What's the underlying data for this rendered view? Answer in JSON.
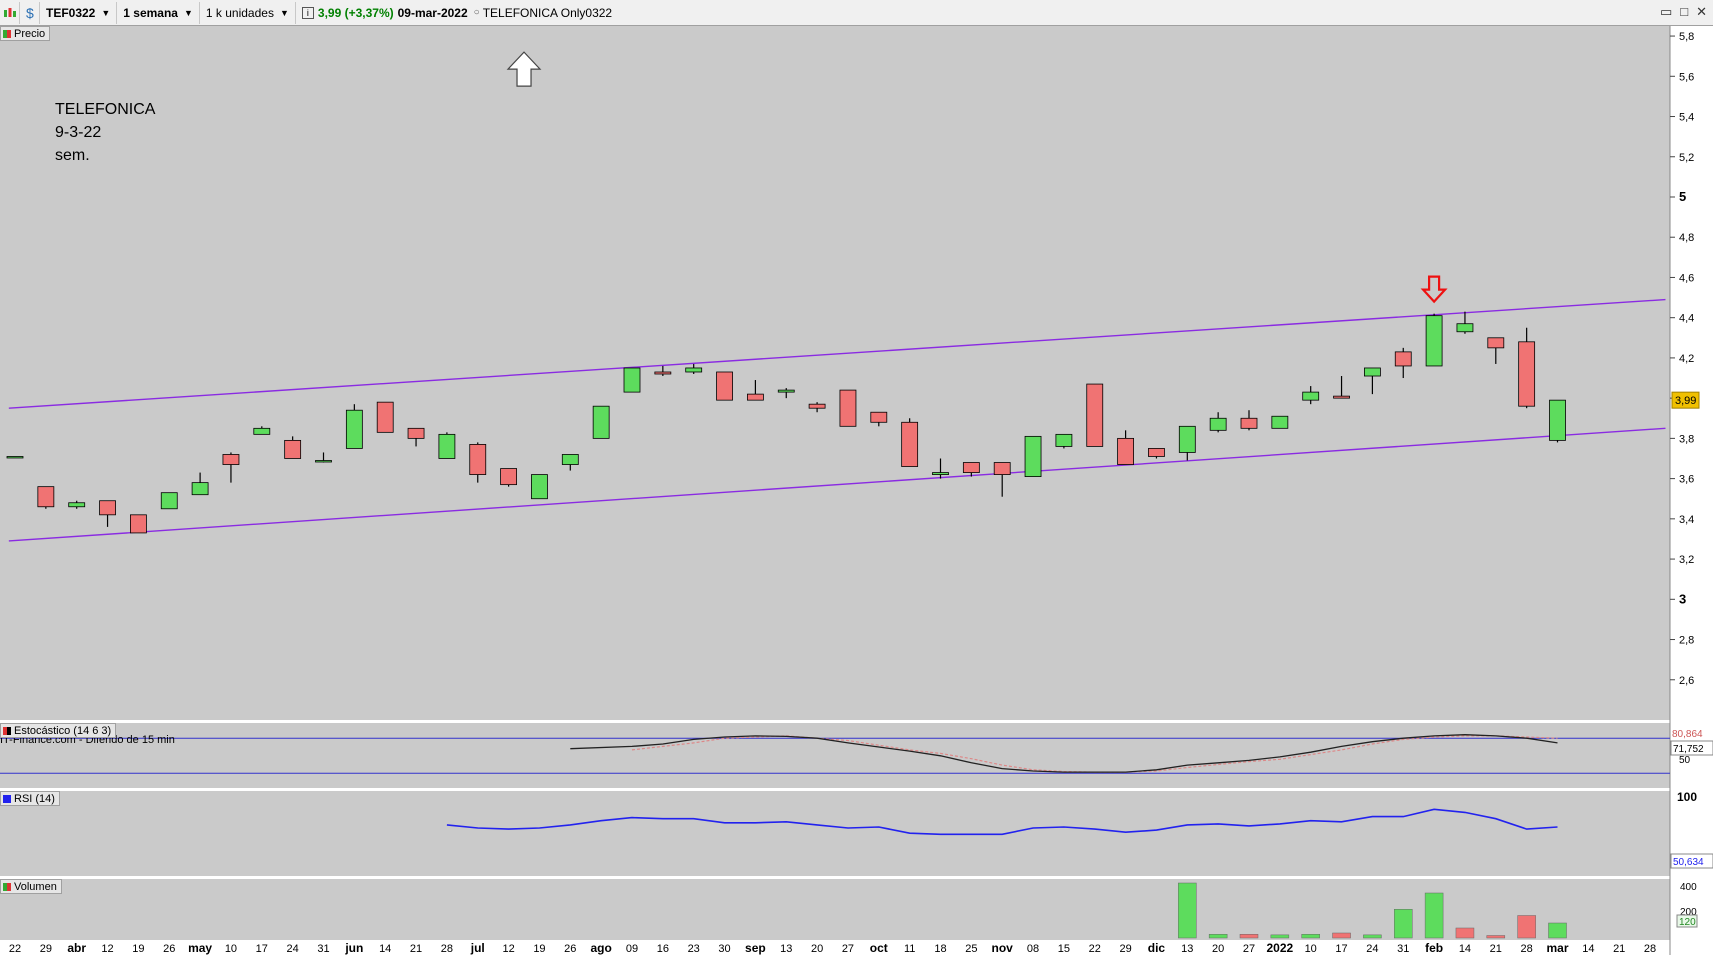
{
  "toolbar": {
    "symbol": "TEF0322",
    "timeframe": "1 semana",
    "units": "1 k unidades",
    "info_icon": "i",
    "quote": "3,99 (+3,37%)",
    "date": "09-mar-2022",
    "instrument": "TELEFONICA Only0322",
    "icons": [
      "candlestick-chart-icon",
      "dollar-icon",
      "info-icon"
    ]
  },
  "window_buttons": [
    "minimize-icon",
    "maximize-icon",
    "close-icon"
  ],
  "panels": {
    "price": "Precio",
    "stochastic": "Estocástico (14 6 3)",
    "rsi": "RSI (14)",
    "volume": "Volumen"
  },
  "note_lines": [
    "TELEFONICA",
    "9-3-22",
    "sem."
  ],
  "source_text": "IT-Finance.com - Diferido de 15 min",
  "colors": {
    "chart_bg": "#cacaca",
    "up": "#5ddc5d",
    "down": "#f07373",
    "channel": "#8a2be2",
    "rsi": "#2222ee",
    "marker_red": "#ee1111",
    "price_badge": "#f0c000"
  },
  "chart_data": {
    "type": "candlestick",
    "price_axis": {
      "range": [
        2.4,
        5.85
      ],
      "ticks": [
        "5,8",
        "5,6",
        "5,4",
        "5,2",
        "5",
        "4,8",
        "4,6",
        "4,4",
        "4,2",
        "4",
        "3,8",
        "3,6",
        "3,4",
        "3,2",
        "3",
        "2,8",
        "2,6"
      ],
      "last_price": "3,99"
    },
    "x_labels": [
      {
        "i": 0,
        "t": "22",
        "b": false
      },
      {
        "i": 1,
        "t": "29",
        "b": false
      },
      {
        "i": 2,
        "t": "abr",
        "b": true
      },
      {
        "i": 3,
        "t": "12",
        "b": false
      },
      {
        "i": 4,
        "t": "19",
        "b": false
      },
      {
        "i": 5,
        "t": "26",
        "b": false
      },
      {
        "i": 6,
        "t": "may",
        "b": true
      },
      {
        "i": 7,
        "t": "10",
        "b": false
      },
      {
        "i": 8,
        "t": "17",
        "b": false
      },
      {
        "i": 9,
        "t": "24",
        "b": false
      },
      {
        "i": 10,
        "t": "31",
        "b": false
      },
      {
        "i": 11,
        "t": "jun",
        "b": true
      },
      {
        "i": 12,
        "t": "14",
        "b": false
      },
      {
        "i": 13,
        "t": "21",
        "b": false
      },
      {
        "i": 14,
        "t": "28",
        "b": false
      },
      {
        "i": 15,
        "t": "jul",
        "b": true
      },
      {
        "i": 16,
        "t": "12",
        "b": false
      },
      {
        "i": 17,
        "t": "19",
        "b": false
      },
      {
        "i": 18,
        "t": "26",
        "b": false
      },
      {
        "i": 19,
        "t": "ago",
        "b": true
      },
      {
        "i": 20,
        "t": "09",
        "b": false
      },
      {
        "i": 21,
        "t": "16",
        "b": false
      },
      {
        "i": 22,
        "t": "23",
        "b": false
      },
      {
        "i": 23,
        "t": "30",
        "b": false
      },
      {
        "i": 24,
        "t": "sep",
        "b": true
      },
      {
        "i": 25,
        "t": "13",
        "b": false
      },
      {
        "i": 26,
        "t": "20",
        "b": false
      },
      {
        "i": 27,
        "t": "27",
        "b": false
      },
      {
        "i": 28,
        "t": "oct",
        "b": true
      },
      {
        "i": 29,
        "t": "11",
        "b": false
      },
      {
        "i": 30,
        "t": "18",
        "b": false
      },
      {
        "i": 31,
        "t": "25",
        "b": false
      },
      {
        "i": 32,
        "t": "nov",
        "b": true
      },
      {
        "i": 33,
        "t": "08",
        "b": false
      },
      {
        "i": 34,
        "t": "15",
        "b": false
      },
      {
        "i": 35,
        "t": "22",
        "b": false
      },
      {
        "i": 36,
        "t": "29",
        "b": false
      },
      {
        "i": 37,
        "t": "dic",
        "b": true
      },
      {
        "i": 38,
        "t": "13",
        "b": false
      },
      {
        "i": 39,
        "t": "20",
        "b": false
      },
      {
        "i": 40,
        "t": "27",
        "b": false
      },
      {
        "i": 41,
        "t": "2022",
        "b": true
      },
      {
        "i": 42,
        "t": "10",
        "b": false
      },
      {
        "i": 43,
        "t": "17",
        "b": false
      },
      {
        "i": 44,
        "t": "24",
        "b": false
      },
      {
        "i": 45,
        "t": "31",
        "b": false
      },
      {
        "i": 46,
        "t": "feb",
        "b": true
      },
      {
        "i": 47,
        "t": "14",
        "b": false
      },
      {
        "i": 48,
        "t": "21",
        "b": false
      },
      {
        "i": 49,
        "t": "28",
        "b": false
      },
      {
        "i": 50,
        "t": "mar",
        "b": true
      },
      {
        "i": 51,
        "t": "14",
        "b": false
      },
      {
        "i": 52,
        "t": "21",
        "b": false
      },
      {
        "i": 53,
        "t": "28",
        "b": false
      }
    ],
    "candles": [
      {
        "i": 0,
        "o": 3.71,
        "h": 3.71,
        "l": 3.71,
        "c": 3.71
      },
      {
        "i": 1,
        "o": 3.56,
        "h": 3.56,
        "l": 3.45,
        "c": 3.46
      },
      {
        "i": 2,
        "o": 3.46,
        "h": 3.49,
        "l": 3.45,
        "c": 3.48
      },
      {
        "i": 3,
        "o": 3.49,
        "h": 3.49,
        "l": 3.36,
        "c": 3.42
      },
      {
        "i": 4,
        "o": 3.42,
        "h": 3.42,
        "l": 3.33,
        "c": 3.33
      },
      {
        "i": 5,
        "o": 3.45,
        "h": 3.53,
        "l": 3.45,
        "c": 3.53
      },
      {
        "i": 6,
        "o": 3.52,
        "h": 3.63,
        "l": 3.52,
        "c": 3.58
      },
      {
        "i": 7,
        "o": 3.72,
        "h": 3.73,
        "l": 3.58,
        "c": 3.67
      },
      {
        "i": 8,
        "o": 3.82,
        "h": 3.86,
        "l": 3.82,
        "c": 3.85
      },
      {
        "i": 9,
        "o": 3.79,
        "h": 3.81,
        "l": 3.7,
        "c": 3.7
      },
      {
        "i": 10,
        "o": 3.69,
        "h": 3.73,
        "l": 3.68,
        "c": 3.69
      },
      {
        "i": 11,
        "o": 3.75,
        "h": 3.97,
        "l": 3.75,
        "c": 3.94
      },
      {
        "i": 12,
        "o": 3.98,
        "h": 3.98,
        "l": 3.83,
        "c": 3.83
      },
      {
        "i": 13,
        "o": 3.85,
        "h": 3.85,
        "l": 3.76,
        "c": 3.8
      },
      {
        "i": 14,
        "o": 3.7,
        "h": 3.83,
        "l": 3.7,
        "c": 3.82
      },
      {
        "i": 15,
        "o": 3.77,
        "h": 3.78,
        "l": 3.58,
        "c": 3.62
      },
      {
        "i": 16,
        "o": 3.65,
        "h": 3.65,
        "l": 3.56,
        "c": 3.57
      },
      {
        "i": 17,
        "o": 3.5,
        "h": 3.62,
        "l": 3.5,
        "c": 3.62
      },
      {
        "i": 18,
        "o": 3.67,
        "h": 3.72,
        "l": 3.64,
        "c": 3.72
      },
      {
        "i": 19,
        "o": 3.8,
        "h": 3.96,
        "l": 3.8,
        "c": 3.96
      },
      {
        "i": 20,
        "o": 4.03,
        "h": 4.15,
        "l": 4.03,
        "c": 4.15
      },
      {
        "i": 21,
        "o": 4.13,
        "h": 4.16,
        "l": 4.11,
        "c": 4.12
      },
      {
        "i": 22,
        "o": 4.13,
        "h": 4.17,
        "l": 4.12,
        "c": 4.15
      },
      {
        "i": 23,
        "o": 4.13,
        "h": 4.13,
        "l": 3.99,
        "c": 3.99
      },
      {
        "i": 24,
        "o": 4.02,
        "h": 4.09,
        "l": 3.99,
        "c": 3.99
      },
      {
        "i": 25,
        "o": 4.03,
        "h": 4.05,
        "l": 4.0,
        "c": 4.04
      },
      {
        "i": 26,
        "o": 3.97,
        "h": 3.98,
        "l": 3.93,
        "c": 3.95
      },
      {
        "i": 27,
        "o": 4.04,
        "h": 4.04,
        "l": 3.86,
        "c": 3.86
      },
      {
        "i": 28,
        "o": 3.93,
        "h": 3.93,
        "l": 3.86,
        "c": 3.88
      },
      {
        "i": 29,
        "o": 3.88,
        "h": 3.9,
        "l": 3.66,
        "c": 3.66
      },
      {
        "i": 30,
        "o": 3.62,
        "h": 3.7,
        "l": 3.6,
        "c": 3.63
      },
      {
        "i": 31,
        "o": 3.68,
        "h": 3.68,
        "l": 3.61,
        "c": 3.63
      },
      {
        "i": 32,
        "o": 3.68,
        "h": 3.68,
        "l": 3.51,
        "c": 3.62
      },
      {
        "i": 33,
        "o": 3.61,
        "h": 3.81,
        "l": 3.61,
        "c": 3.81
      },
      {
        "i": 34,
        "o": 3.76,
        "h": 3.82,
        "l": 3.75,
        "c": 3.82
      },
      {
        "i": 35,
        "o": 4.07,
        "h": 4.07,
        "l": 3.76,
        "c": 3.76
      },
      {
        "i": 36,
        "o": 3.8,
        "h": 3.84,
        "l": 3.67,
        "c": 3.67
      },
      {
        "i": 37,
        "o": 3.75,
        "h": 3.75,
        "l": 3.7,
        "c": 3.71
      },
      {
        "i": 38,
        "o": 3.73,
        "h": 3.86,
        "l": 3.69,
        "c": 3.86
      },
      {
        "i": 39,
        "o": 3.84,
        "h": 3.93,
        "l": 3.83,
        "c": 3.9
      },
      {
        "i": 40,
        "o": 3.9,
        "h": 3.94,
        "l": 3.84,
        "c": 3.85
      },
      {
        "i": 41,
        "o": 3.85,
        "h": 3.91,
        "l": 3.85,
        "c": 3.91
      },
      {
        "i": 42,
        "o": 3.99,
        "h": 4.06,
        "l": 3.97,
        "c": 4.03
      },
      {
        "i": 43,
        "o": 4.01,
        "h": 4.11,
        "l": 4.0,
        "c": 4.0
      },
      {
        "i": 44,
        "o": 4.11,
        "h": 4.15,
        "l": 4.02,
        "c": 4.15
      },
      {
        "i": 45,
        "o": 4.23,
        "h": 4.25,
        "l": 4.1,
        "c": 4.16
      },
      {
        "i": 46,
        "o": 4.16,
        "h": 4.42,
        "l": 4.16,
        "c": 4.41
      },
      {
        "i": 47,
        "o": 4.33,
        "h": 4.43,
        "l": 4.32,
        "c": 4.37
      },
      {
        "i": 48,
        "o": 4.3,
        "h": 4.3,
        "l": 4.17,
        "c": 4.25
      },
      {
        "i": 49,
        "o": 4.28,
        "h": 4.35,
        "l": 3.95,
        "c": 3.96
      },
      {
        "i": 50,
        "o": 3.79,
        "h": 3.99,
        "l": 3.78,
        "c": 3.99
      }
    ],
    "channel_lines": [
      {
        "x0": -0.2,
        "y0": 3.95,
        "x1": 53.5,
        "y1": 4.49
      },
      {
        "x0": -0.2,
        "y0": 3.29,
        "x1": 53.5,
        "y1": 3.85
      }
    ],
    "annotations": [
      {
        "type": "arrow-up",
        "x": 16.5,
        "y": 5.72,
        "color": "#ffffff"
      },
      {
        "type": "arrow-down",
        "x": 46,
        "y": 4.48,
        "color": "#ee1111"
      }
    ],
    "stochastic": {
      "range": [
        0,
        100
      ],
      "levels": [
        80,
        20
      ],
      "ticks": [
        "80,864",
        "71,752",
        "50"
      ],
      "k": [
        [
          18,
          62
        ],
        [
          20,
          66
        ],
        [
          21,
          70
        ],
        [
          22,
          78
        ],
        [
          23,
          82
        ],
        [
          24,
          84
        ],
        [
          25,
          83
        ],
        [
          26,
          80
        ],
        [
          27,
          72
        ],
        [
          28,
          65
        ],
        [
          29,
          58
        ],
        [
          30,
          50
        ],
        [
          31,
          38
        ],
        [
          32,
          28
        ],
        [
          33,
          24
        ],
        [
          34,
          22
        ],
        [
          35,
          22
        ],
        [
          36,
          22
        ],
        [
          37,
          26
        ],
        [
          38,
          34
        ],
        [
          39,
          38
        ],
        [
          40,
          42
        ],
        [
          41,
          48
        ],
        [
          42,
          56
        ],
        [
          43,
          66
        ],
        [
          44,
          74
        ],
        [
          45,
          80
        ],
        [
          46,
          84
        ],
        [
          47,
          86
        ],
        [
          48,
          84
        ],
        [
          49,
          80
        ],
        [
          50,
          72
        ]
      ],
      "d": [
        [
          20,
          60
        ],
        [
          21,
          66
        ],
        [
          22,
          72
        ],
        [
          23,
          80
        ],
        [
          24,
          82
        ],
        [
          25,
          84
        ],
        [
          26,
          80
        ],
        [
          27,
          76
        ],
        [
          28,
          68
        ],
        [
          29,
          60
        ],
        [
          30,
          54
        ],
        [
          31,
          45
        ],
        [
          32,
          34
        ],
        [
          33,
          26
        ],
        [
          34,
          23
        ],
        [
          35,
          22
        ],
        [
          36,
          22
        ],
        [
          37,
          24
        ],
        [
          38,
          30
        ],
        [
          39,
          35
        ],
        [
          40,
          40
        ],
        [
          41,
          44
        ],
        [
          42,
          52
        ],
        [
          43,
          60
        ],
        [
          44,
          70
        ],
        [
          45,
          78
        ],
        [
          46,
          82
        ],
        [
          47,
          84
        ],
        [
          48,
          84
        ],
        [
          49,
          82
        ],
        [
          50,
          80
        ]
      ],
      "last_k": "71,752",
      "last_d": "80,864"
    },
    "rsi": {
      "range": [
        0,
        100
      ],
      "ticks": [
        "100"
      ],
      "values": [
        [
          14,
          52
        ],
        [
          15,
          49
        ],
        [
          16,
          48
        ],
        [
          17,
          49
        ],
        [
          18,
          52
        ],
        [
          19,
          56
        ],
        [
          20,
          59
        ],
        [
          21,
          58
        ],
        [
          22,
          58
        ],
        [
          23,
          54
        ],
        [
          24,
          54
        ],
        [
          25,
          55
        ],
        [
          26,
          52
        ],
        [
          27,
          49
        ],
        [
          28,
          50
        ],
        [
          29,
          44
        ],
        [
          30,
          43
        ],
        [
          31,
          43
        ],
        [
          32,
          43
        ],
        [
          33,
          49
        ],
        [
          34,
          50
        ],
        [
          35,
          48
        ],
        [
          36,
          45
        ],
        [
          37,
          47
        ],
        [
          38,
          52
        ],
        [
          39,
          53
        ],
        [
          40,
          51
        ],
        [
          41,
          53
        ],
        [
          42,
          56
        ],
        [
          43,
          55
        ],
        [
          44,
          60
        ],
        [
          45,
          60
        ],
        [
          46,
          67
        ],
        [
          47,
          64
        ],
        [
          48,
          58
        ],
        [
          49,
          48
        ],
        [
          50,
          50
        ]
      ],
      "last": "50,634"
    },
    "volume": {
      "ticks": [
        "400",
        "200"
      ],
      "last": "120",
      "bars": [
        [
          38,
          440,
          true
        ],
        [
          39,
          30,
          true
        ],
        [
          40,
          30,
          false
        ],
        [
          41,
          25,
          true
        ],
        [
          42,
          30,
          true
        ],
        [
          43,
          40,
          false
        ],
        [
          44,
          25,
          true
        ],
        [
          45,
          230,
          true
        ],
        [
          46,
          360,
          true
        ],
        [
          47,
          80,
          false
        ],
        [
          48,
          20,
          false
        ],
        [
          49,
          180,
          false
        ],
        [
          50,
          120,
          true
        ]
      ]
    }
  }
}
